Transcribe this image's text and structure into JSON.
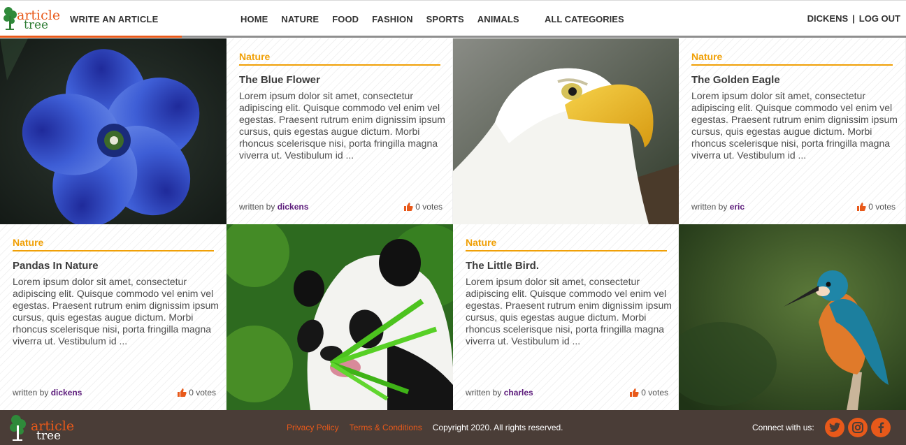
{
  "header": {
    "logo_top": "article",
    "logo_bottom": "tree",
    "write_article": "WRITE AN ARTICLE",
    "nav": [
      "HOME",
      "NATURE",
      "FOOD",
      "FASHION",
      "SPORTS",
      "ANIMALS"
    ],
    "all_categories": "ALL CATEGORIES",
    "username": "DICKENS",
    "separator": "|",
    "logout": "LOG OUT"
  },
  "articles": [
    {
      "category": "Nature",
      "title": "The Blue Flower",
      "excerpt": "Lorem ipsum dolor sit amet, consectetur adipiscing elit. Quisque commodo vel enim vel egestas. Praesent rutrum enim dignissim ipsum cursus, quis egestas augue dictum. Morbi rhoncus scelerisque nisi, porta fringilla magna viverra ut. Vestibulum id ...",
      "written_by": "written by",
      "author": "dickens",
      "votes": "0 votes",
      "image": "blue-flower"
    },
    {
      "category": "Nature",
      "title": "The Golden Eagle",
      "excerpt": "Lorem ipsum dolor sit amet, consectetur adipiscing elit. Quisque commodo vel enim vel egestas. Praesent rutrum enim dignissim ipsum cursus, quis egestas augue dictum. Morbi rhoncus scelerisque nisi, porta fringilla magna viverra ut. Vestibulum id ...",
      "written_by": "written by",
      "author": "eric",
      "votes": "0 votes",
      "image": "bald-eagle"
    },
    {
      "category": "Nature",
      "title": "Pandas In Nature",
      "excerpt": "Lorem ipsum dolor sit amet, consectetur adipiscing elit. Quisque commodo vel enim vel egestas. Praesent rutrum enim dignissim ipsum cursus, quis egestas augue dictum. Morbi rhoncus scelerisque nisi, porta fringilla magna viverra ut. Vestibulum id ...",
      "written_by": "written by",
      "author": "dickens",
      "votes": "0 votes",
      "image": "panda"
    },
    {
      "category": "Nature",
      "title": "The Little Bird.",
      "excerpt": "Lorem ipsum dolor sit amet, consectetur adipiscing elit. Quisque commodo vel enim vel egestas. Praesent rutrum enim dignissim ipsum cursus, quis egestas augue dictum. Morbi rhoncus scelerisque nisi, porta fringilla magna viverra ut. Vestibulum id ...",
      "written_by": "written by",
      "author": "charles",
      "votes": "0 votes",
      "image": "kingfisher"
    }
  ],
  "footer": {
    "logo_top": "article",
    "logo_bottom": "tree",
    "privacy": "Privacy Policy",
    "terms": "Terms & Conditions",
    "copyright": "Copyright 2020. All rights reserved.",
    "connect": "Connect with us:",
    "social": [
      "twitter-icon",
      "instagram-icon",
      "facebook-icon"
    ]
  },
  "colors": {
    "accent": "#e8591a",
    "category": "#f0a007",
    "author": "#5b1a7a",
    "footer_bg": "#4a3d37"
  }
}
